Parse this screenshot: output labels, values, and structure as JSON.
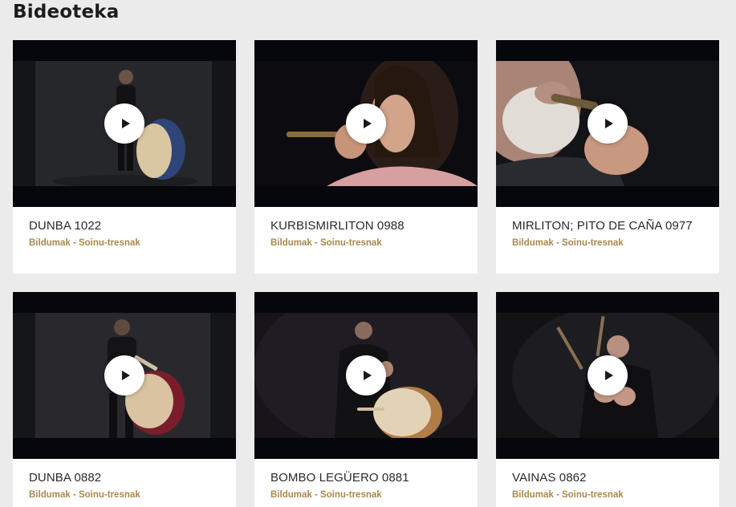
{
  "page": {
    "title": "Bideoteka"
  },
  "accent_color": "#a9884c",
  "videos": [
    {
      "title": "DUNBA 1022",
      "category": "Bildumak - Soinu-tresnak",
      "icon": "play-icon"
    },
    {
      "title": "KURBISMIRLITON 0988",
      "category": "Bildumak - Soinu-tresnak",
      "icon": "play-icon"
    },
    {
      "title": "MIRLITON; PITO DE CAÑA 0977",
      "category": "Bildumak - Soinu-tresnak",
      "icon": "play-icon"
    },
    {
      "title": "DUNBA 0882",
      "category": "Bildumak - Soinu-tresnak",
      "icon": "play-icon"
    },
    {
      "title": "BOMBO LEGÜERO 0881",
      "category": "Bildumak - Soinu-tresnak",
      "icon": "play-icon"
    },
    {
      "title": "VAINAS 0862",
      "category": "Bildumak - Soinu-tresnak",
      "icon": "play-icon"
    }
  ]
}
